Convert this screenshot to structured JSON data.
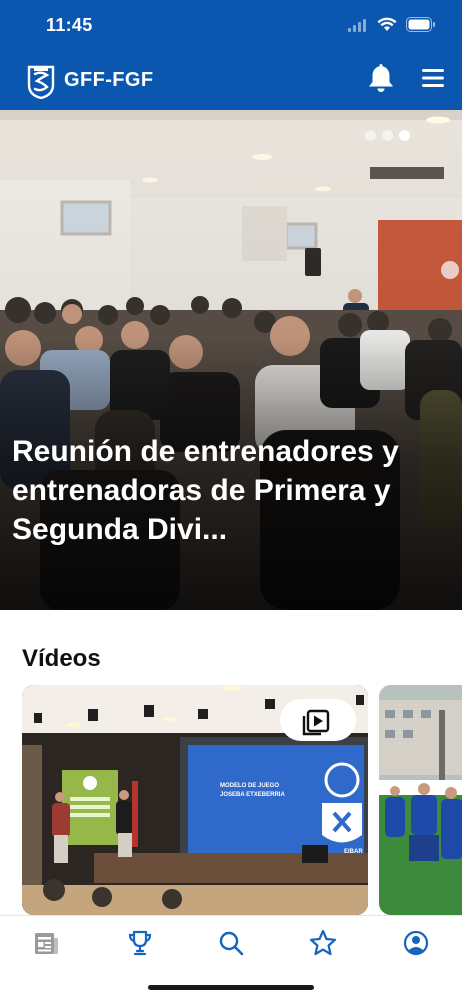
{
  "status_bar": {
    "time": "11:45"
  },
  "header": {
    "brand": "GFF-FGF"
  },
  "hero": {
    "title": "Reunión de entrenadores y entrenadoras de Primera y Segunda Divi...",
    "slides": 3,
    "active_slide": 3
  },
  "videos": {
    "section_title": "Vídeos",
    "slide_title_line1": "MODELO DE JUEGO",
    "slide_title_line2": "JOSEBA ETXEBERRIA",
    "club_text": "EIBAR"
  },
  "tabbar": {
    "items": [
      {
        "icon": "news-icon",
        "active": false
      },
      {
        "icon": "trophy-icon",
        "active": false
      },
      {
        "icon": "search-icon",
        "active": false
      },
      {
        "icon": "star-icon",
        "active": false
      },
      {
        "icon": "profile-icon",
        "active": false
      }
    ]
  },
  "colors": {
    "brand_blue": "#0b57b0",
    "accent": "#1565c0",
    "inactive": "#9a9a9a"
  }
}
